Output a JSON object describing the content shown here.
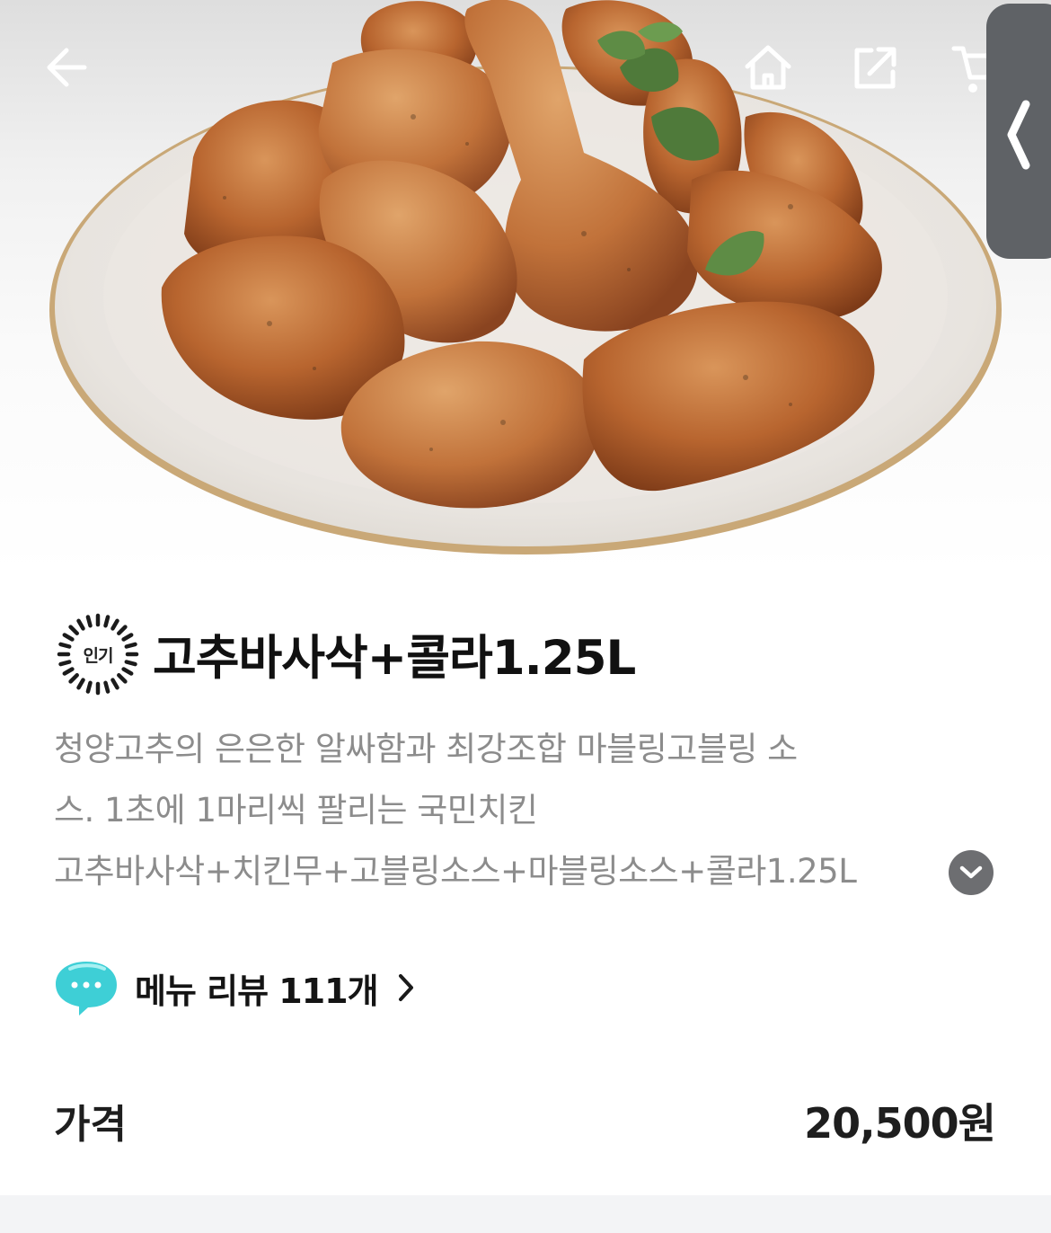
{
  "header": {
    "back_icon": "arrow-left-icon",
    "home_icon": "home-icon",
    "share_icon": "share-icon",
    "cart_icon": "cart-icon",
    "side_handle_icon": "chevron-left-icon"
  },
  "product": {
    "badge": "인기",
    "name": "고추바사삭+콜라1.25L",
    "description_lines": [
      "청양고추의 은은한 알싸함과 최강조합 마블링고블링 소",
      "스. 1초에 1마리씩 팔리는 국민치킨",
      "고추바사삭+치킨무+고블링소스+마블링소스+콜라1.25L"
    ],
    "expand_icon": "chevron-down-icon"
  },
  "reviews": {
    "label": "메뉴 리뷰 111개",
    "icon": "chat-bubble-icon",
    "arrow_icon": "chevron-right-icon"
  },
  "price": {
    "label": "가격",
    "value": "20,500원"
  },
  "colors": {
    "side_handle": "#5f6266",
    "description": "#8c8c8c",
    "review_icon": "#3ecfd6"
  }
}
